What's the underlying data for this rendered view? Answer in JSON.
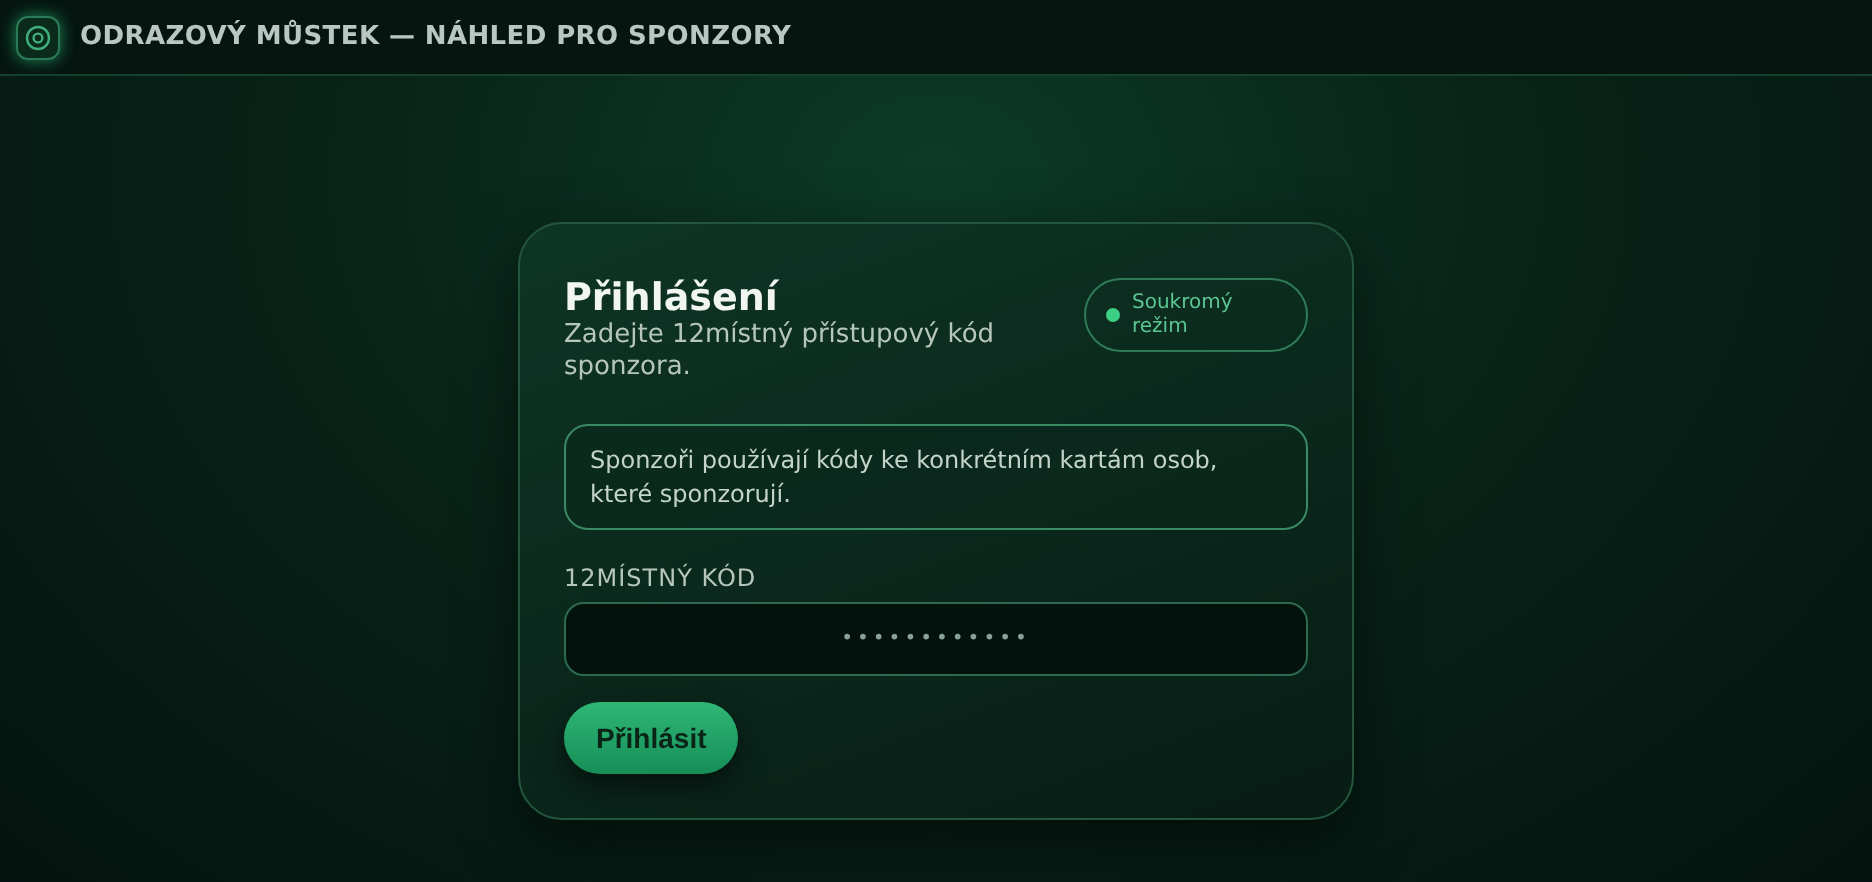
{
  "header": {
    "title": "ODRAZOVÝ MŮSTEK — NÁHLED PRO SPONZORY"
  },
  "login": {
    "title": "Přihlášení",
    "subtitle": "Zadejte 12místný přístupový kód sponzora.",
    "badge": {
      "label": "Soukromý režim",
      "on": true
    },
    "notice": "Sponzoři používají kódy ke konkrétním kartám osob, které sponzorují.",
    "code_field": {
      "label": "12MÍSTNÝ KÓD",
      "value": "••••••••••••"
    },
    "submit": "Přihlásit"
  }
}
